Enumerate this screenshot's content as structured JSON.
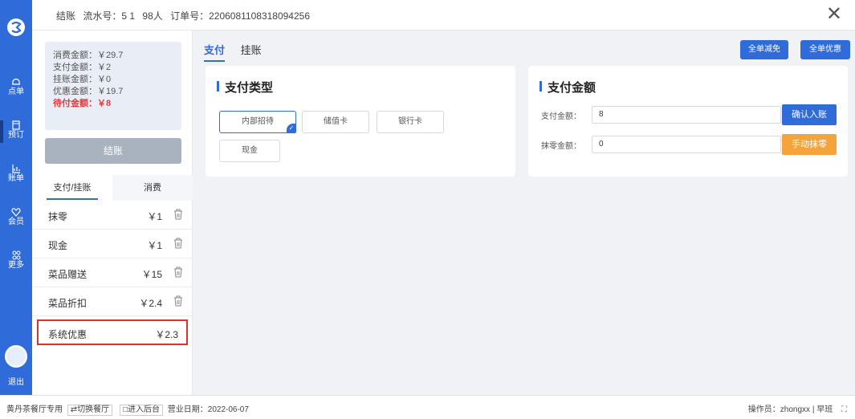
{
  "header": {
    "label_checkout": "结账",
    "serial": "流水号：5 1",
    "guests": "98人",
    "order": "订单号：2206081108318094256"
  },
  "rail": {
    "items": [
      {
        "label": "点单",
        "icon": "bell-icon"
      },
      {
        "label": "预订",
        "icon": "calendar-icon"
      },
      {
        "label": "账单",
        "icon": "chart-icon"
      },
      {
        "label": "会员",
        "icon": "heart-icon"
      },
      {
        "label": "更多",
        "icon": "grid-icon"
      }
    ],
    "logout": "退出"
  },
  "summary": {
    "consume": "消费金额：￥29.7",
    "paid": "支付金额：￥2",
    "credit": "挂账金额：￥0",
    "discount": "优惠金额：￥19.7",
    "due": "待付金额：￥8"
  },
  "checkout_button": "结账",
  "left_tabs": [
    "支付/挂账",
    "消费"
  ],
  "items": [
    {
      "name": "抹零",
      "amount": "￥1"
    },
    {
      "name": "现金",
      "amount": "￥1"
    },
    {
      "name": "菜品赠送",
      "amount": "￥15"
    },
    {
      "name": "菜品折扣",
      "amount": "￥2.4"
    },
    {
      "name": "系统优惠",
      "amount": "￥2.3"
    }
  ],
  "pay_tabs": [
    "支付",
    "挂账"
  ],
  "top_buttons": {
    "reduce_all": "全单减免",
    "discount_all": "全单优惠"
  },
  "pay_type": {
    "title": "支付类型",
    "options": [
      "内部招待",
      "储值卡",
      "银行卡",
      "现金"
    ],
    "selected": "内部招待"
  },
  "pay_amount": {
    "title": "支付金额",
    "pay_label": "支付金额：",
    "pay_value": "8",
    "round_label": "抹零金额：",
    "round_value": "0",
    "confirm_button": "确认入账",
    "round_button": "手动抹零"
  },
  "status": {
    "store": "黄丹茶餐厅专用",
    "switch": "切换餐厅",
    "backend": "进入后台",
    "date": "营业日期：2022-06-07",
    "operator": "操作员：zhongxx | 早班"
  },
  "colors": {
    "primary": "#2f6bd9",
    "danger": "#e03a3a",
    "orange": "#f5a43a"
  }
}
